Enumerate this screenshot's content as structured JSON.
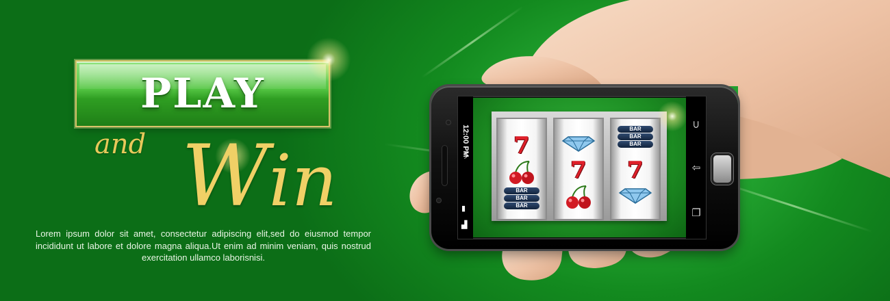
{
  "banner": {
    "play_label": "PLAY",
    "and_label": "and",
    "win_label": "Win",
    "body_text": "Lorem ipsum dolor sit amet, consectetur adipiscing elit,sed do eiusmod tempor incididunt ut labore et dolore magna aliqua.Ut enim ad minim veniam, quis nostrud exercitation ullamco laborisnisi."
  },
  "colors": {
    "background_green": "#138a1f",
    "button_green": "#55c644",
    "gold": "#f0d066",
    "seven_red": "#e0202a",
    "bar_navy": "#1c3352"
  },
  "phone": {
    "status_time": "12:00 PM",
    "icons": {
      "wifi": "wifi-icon",
      "battery": "battery-icon",
      "signal": "signal-icon",
      "back": "back-icon",
      "home": "home-icon",
      "recent": "recent-apps-icon"
    }
  },
  "slot": {
    "bar_label": "BAR",
    "reels": [
      [
        "7",
        "cherry",
        "BAR x3"
      ],
      [
        "diamond",
        "7",
        "cherry"
      ],
      [
        "BAR x3",
        "7",
        "diamond"
      ]
    ]
  }
}
